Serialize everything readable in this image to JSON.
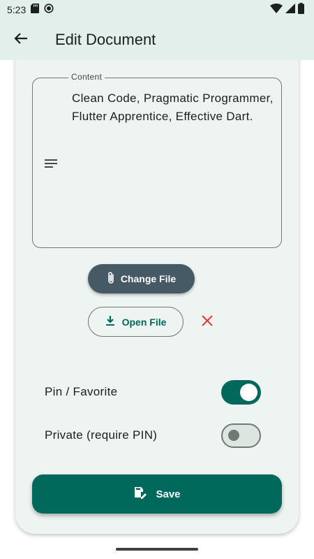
{
  "status_bar": {
    "time": "5:23",
    "icons_left": [
      "sd-card-icon",
      "sync-icon"
    ],
    "icons_right": [
      "wifi-icon",
      "cell-signal-icon",
      "battery-icon"
    ]
  },
  "app_bar": {
    "back_icon": "arrow-back-icon",
    "title": "Edit Document"
  },
  "form": {
    "content_field": {
      "label": "Content",
      "icon": "notes-icon",
      "value": "Clean Code, Pragmatic Programmer, Flutter Apprentice, Effective Dart."
    },
    "change_file": {
      "label": "Change File",
      "icon": "paperclip-icon"
    },
    "open_file": {
      "label": "Open File",
      "icon": "download-icon"
    },
    "remove_file": {
      "icon": "close-icon",
      "color": "#e53935"
    },
    "pin_toggle": {
      "label": "Pin / Favorite",
      "on": true
    },
    "private_toggle": {
      "label": "Private (require PIN)",
      "on": false
    },
    "save": {
      "label": "Save",
      "icon": "save-as-icon"
    }
  },
  "colors": {
    "primary": "#00695c",
    "secondary_button": "#455a64",
    "app_bar_bg": "#e3efea",
    "card_bg": "#eef4f1",
    "danger": "#e53935"
  }
}
